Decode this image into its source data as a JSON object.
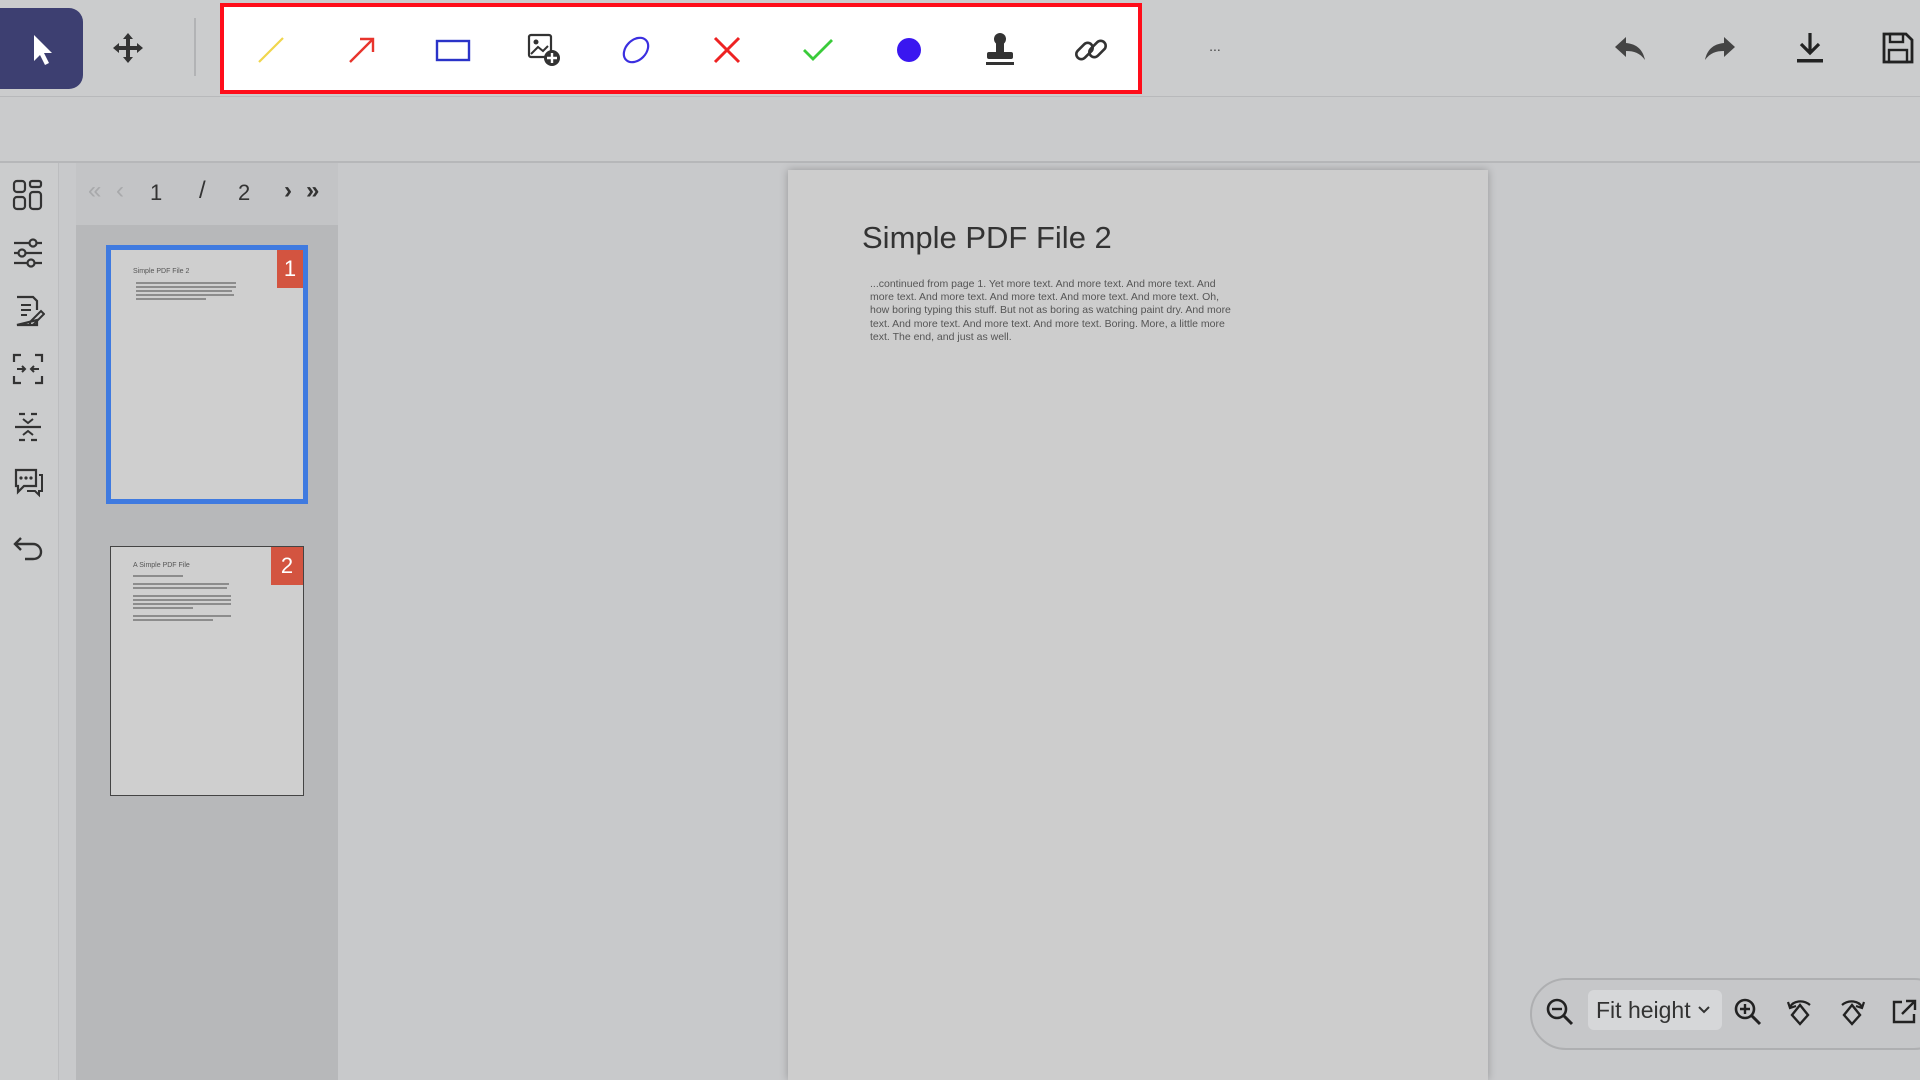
{
  "toolbar": {
    "annotation_tools": [
      "line",
      "arrow",
      "rectangle",
      "image",
      "ellipse",
      "cross",
      "check",
      "dot",
      "stamp",
      "link"
    ],
    "more_label": "...",
    "colors": {
      "accent": "#3d3f71",
      "highlight_border": "#ff0d1a",
      "line": "#f0d64c",
      "arrow": "#e8342c",
      "rectangle": "#2a33c8",
      "ellipse": "#3b2fe0",
      "cross": "#ee2222",
      "check": "#3acb3a",
      "dot": "#3a17f0"
    }
  },
  "pager": {
    "current": "1",
    "separator": "/",
    "total": "2"
  },
  "thumbnails": [
    {
      "badge": "1",
      "title": "Simple PDF File 2"
    },
    {
      "badge": "2",
      "title": "A Simple PDF File"
    }
  ],
  "document": {
    "title": "Simple PDF File 2",
    "body": "...continued from page 1. Yet more text. And more text. And more text. And more text. And more text. And more text. And more text. And more text. Oh, how boring typing this stuff. But not as boring as watching paint dry. And more text. And more text. And more text. And more text. Boring.  More, a little more text. The end, and just as well."
  },
  "zoom": {
    "mode": "Fit height"
  },
  "badge_color": "#d35440",
  "selected_border": "#3f7ae0"
}
